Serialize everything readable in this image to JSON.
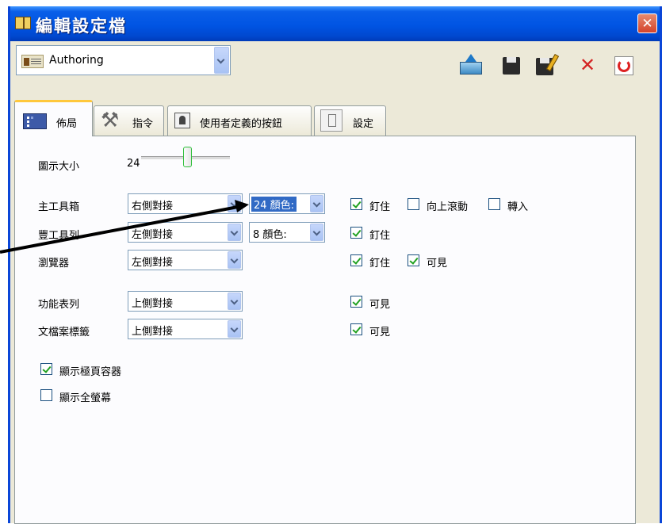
{
  "window": {
    "title": "編輯設定檔",
    "close_label": "✕"
  },
  "profile": {
    "selected": "Authoring"
  },
  "toolbar": {
    "delete_glyph": "✕"
  },
  "tabs": [
    {
      "label": "佈局",
      "active": true
    },
    {
      "label": "指令"
    },
    {
      "label": "使用者定義的按鈕"
    },
    {
      "label": "設定"
    }
  ],
  "layout": {
    "icon_size": {
      "label": "圖示大小",
      "value": "24"
    },
    "rows": [
      {
        "label": "主工具箱",
        "align": "右側對接",
        "colors": "24 顏色:",
        "pin": "釘住",
        "scroll_up": "向上滾動",
        "import": "轉入"
      },
      {
        "label": "豐工具列",
        "align": "左側對接",
        "colors": "8 顏色:",
        "pin": "釘住"
      },
      {
        "label": "瀏覽器",
        "align": "左側對接",
        "pin": "釘住",
        "visible": "可見"
      },
      {
        "label": "功能表列",
        "align": "上側對接",
        "visible": "可見"
      },
      {
        "label": "文檔案標籤",
        "align": "上側對接",
        "visible": "可見"
      }
    ],
    "show_page_container": "顯示極頁容器",
    "show_fullscreen": "顯示全螢幕"
  }
}
